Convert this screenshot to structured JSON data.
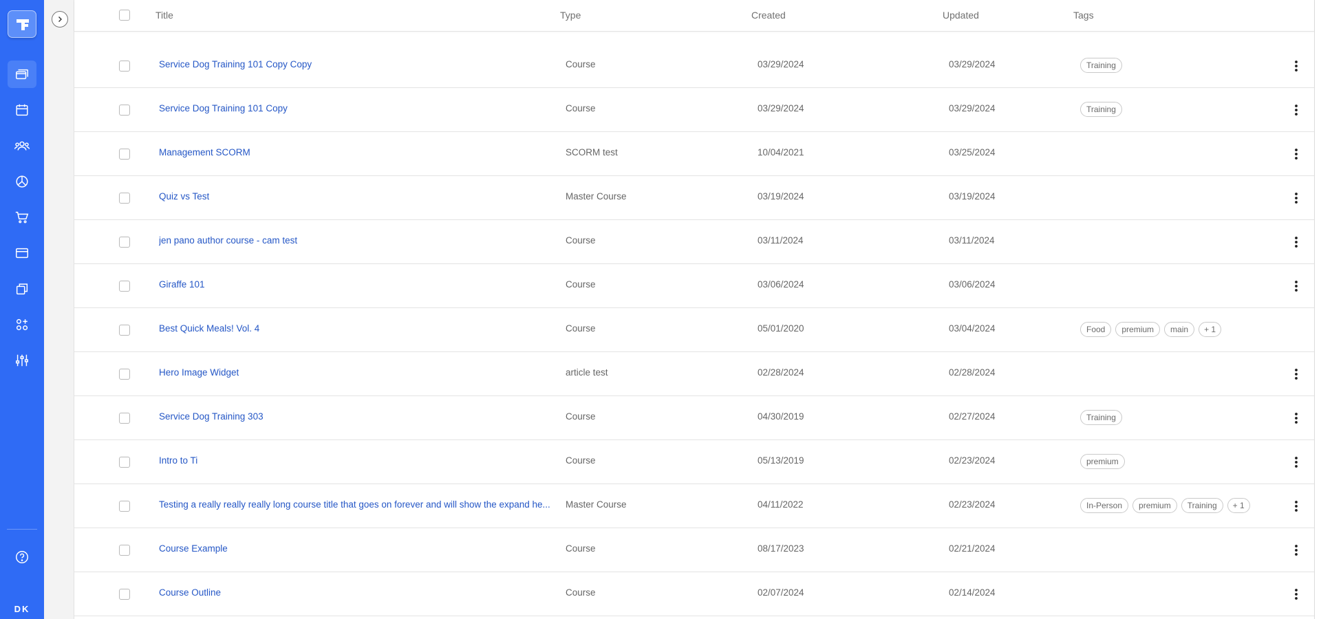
{
  "header": {
    "title": "Title",
    "type": "Type",
    "created": "Created",
    "updated": "Updated",
    "tags": "Tags"
  },
  "sidebar": {
    "items": [
      {
        "icon": "courses-icon",
        "active": true
      },
      {
        "icon": "calendar-icon",
        "active": false
      },
      {
        "icon": "users-icon",
        "active": false
      },
      {
        "icon": "reports-icon",
        "active": false
      },
      {
        "icon": "cart-icon",
        "active": false
      },
      {
        "icon": "browser-window-icon",
        "active": false
      },
      {
        "icon": "copy-icon",
        "active": false
      },
      {
        "icon": "apps-icon",
        "active": false
      },
      {
        "icon": "settings-sliders-icon",
        "active": false
      }
    ],
    "help_icon": "help-icon",
    "user_initials": "DK"
  },
  "colors": {
    "sidebar": "#2f6bf5",
    "link": "#2557c6"
  },
  "rows": [
    {
      "title": "Service Dog Training 101 Copy Copy",
      "type": "Course",
      "created": "03/29/2024",
      "updated": "03/29/2024",
      "tags": [
        "Training"
      ],
      "more": "",
      "menu": true
    },
    {
      "title": "Service Dog Training 101 Copy",
      "type": "Course",
      "created": "03/29/2024",
      "updated": "03/29/2024",
      "tags": [
        "Training"
      ],
      "more": "",
      "menu": true
    },
    {
      "title": "Management SCORM",
      "type": "SCORM test",
      "created": "10/04/2021",
      "updated": "03/25/2024",
      "tags": [],
      "more": "",
      "menu": true
    },
    {
      "title": "Quiz vs Test",
      "type": "Master Course",
      "created": "03/19/2024",
      "updated": "03/19/2024",
      "tags": [],
      "more": "",
      "menu": true
    },
    {
      "title": "jen pano author course - cam test",
      "type": "Course",
      "created": "03/11/2024",
      "updated": "03/11/2024",
      "tags": [],
      "more": "",
      "menu": true
    },
    {
      "title": "Giraffe 101",
      "type": "Course",
      "created": "03/06/2024",
      "updated": "03/06/2024",
      "tags": [],
      "more": "",
      "menu": true
    },
    {
      "title": "Best Quick Meals! Vol. 4",
      "type": "Course",
      "created": "05/01/2020",
      "updated": "03/04/2024",
      "tags": [
        "Food",
        "premium",
        "main"
      ],
      "more": "+ 1",
      "menu": false
    },
    {
      "title": "Hero Image Widget",
      "type": "article test",
      "created": "02/28/2024",
      "updated": "02/28/2024",
      "tags": [],
      "more": "",
      "menu": true
    },
    {
      "title": "Service Dog Training 303",
      "type": "Course",
      "created": "04/30/2019",
      "updated": "02/27/2024",
      "tags": [
        "Training"
      ],
      "more": "",
      "menu": true
    },
    {
      "title": "Intro to Ti",
      "type": "Course",
      "created": "05/13/2019",
      "updated": "02/23/2024",
      "tags": [
        "premium"
      ],
      "more": "",
      "menu": true
    },
    {
      "title": "Testing a really really really long course title that goes on forever and will show the expand he...",
      "type": "Master Course",
      "created": "04/11/2022",
      "updated": "02/23/2024",
      "tags": [
        "In-Person",
        "premium",
        "Training"
      ],
      "more": "+ 1",
      "menu": true
    },
    {
      "title": "Course Example",
      "type": "Course",
      "created": "08/17/2023",
      "updated": "02/21/2024",
      "tags": [],
      "more": "",
      "menu": true
    },
    {
      "title": "Course Outline",
      "type": "Course",
      "created": "02/07/2024",
      "updated": "02/14/2024",
      "tags": [],
      "more": "",
      "menu": true
    }
  ]
}
